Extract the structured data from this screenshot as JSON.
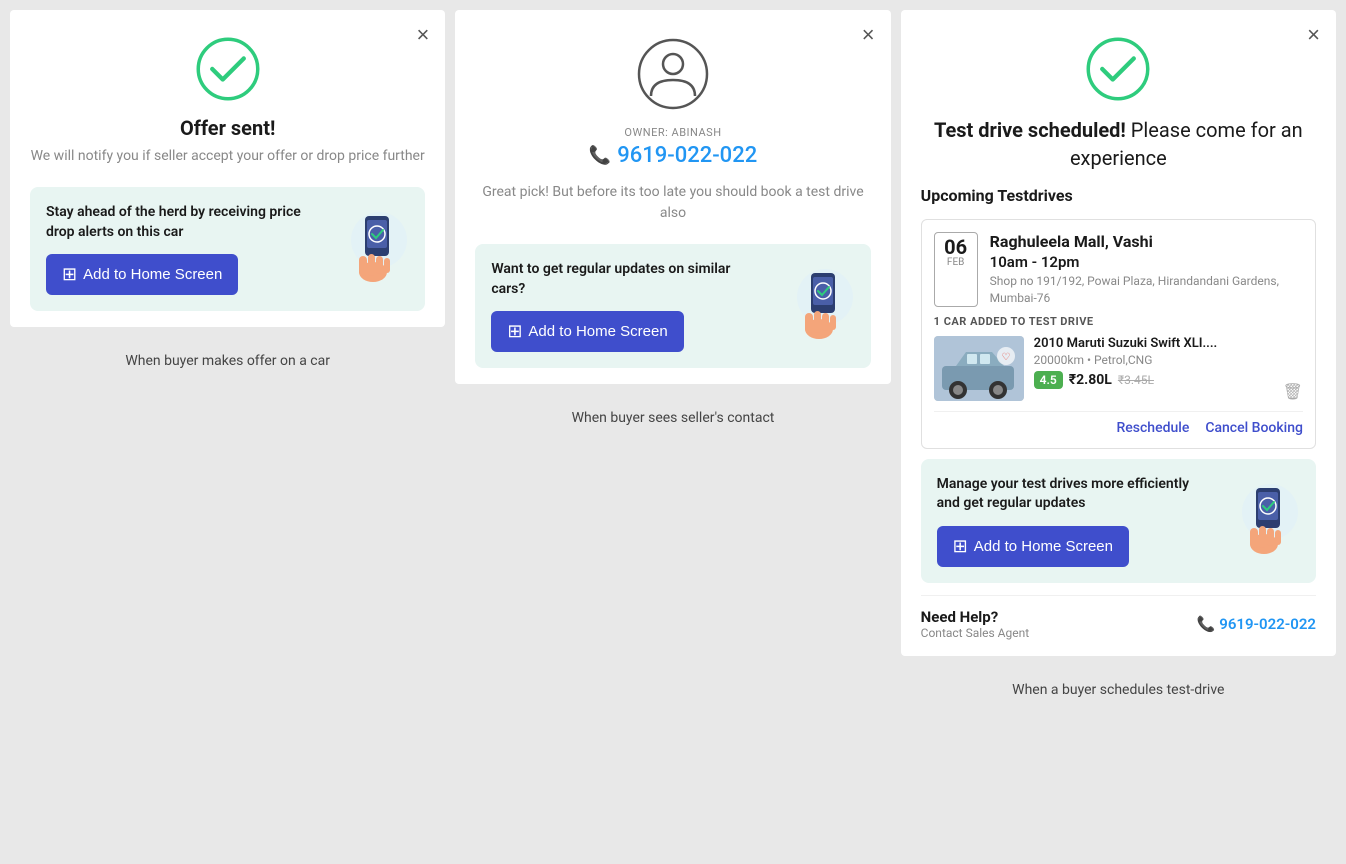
{
  "panel1": {
    "close_label": "×",
    "title": "Offer sent!",
    "subtitle": "We will notify you if seller accept your offer or drop price further",
    "promo_text": "Stay ahead of the herd by receiving price drop alerts on this car",
    "add_home_label": "Add to Home Screen",
    "caption": "When buyer makes offer on a car"
  },
  "panel2": {
    "close_label": "×",
    "owner_label": "OWNER: ABINASH",
    "phone": "9619-022-022",
    "contact_subtitle": "Great pick! But before its too late you should book a test drive also",
    "promo_text": "Want to get regular updates on similar cars?",
    "add_home_label": "Add to Home Screen",
    "caption": "When buyer sees seller's contact"
  },
  "panel3": {
    "close_label": "×",
    "title_bold": "Test drive scheduled!",
    "title_rest": " Please come for an experience",
    "upcoming_label": "Upcoming Testdrives",
    "date_num": "06",
    "date_month": "FEB",
    "location_name": "Raghuleela Mall, Vashi",
    "location_time": "10am - 12pm",
    "location_addr": "Shop no 191/192, Powai Plaza, Hirandandani Gardens, Mumbai-76",
    "car_added_label": "1 CAR ADDED TO TEST DRIVE",
    "car_name": "2010 Maruti Suzuki Swift XLI....",
    "car_specs": "20000km • Petrol,CNG",
    "car_rating": "4.5",
    "car_price": "₹2.80L",
    "car_price_old": "₹3.45L",
    "reschedule_label": "Reschedule",
    "cancel_label": "Cancel Booking",
    "promo_text": "Manage your test drives more efficiently and get regular updates",
    "add_home_label": "Add to Home Screen",
    "help_title": "Need Help?",
    "help_subtitle": "Contact Sales Agent",
    "help_phone": "9619-022-022",
    "caption": "When a buyer schedules test-drive"
  },
  "icons": {
    "plus": "⊞",
    "phone": "📞",
    "delete": "🗑"
  }
}
